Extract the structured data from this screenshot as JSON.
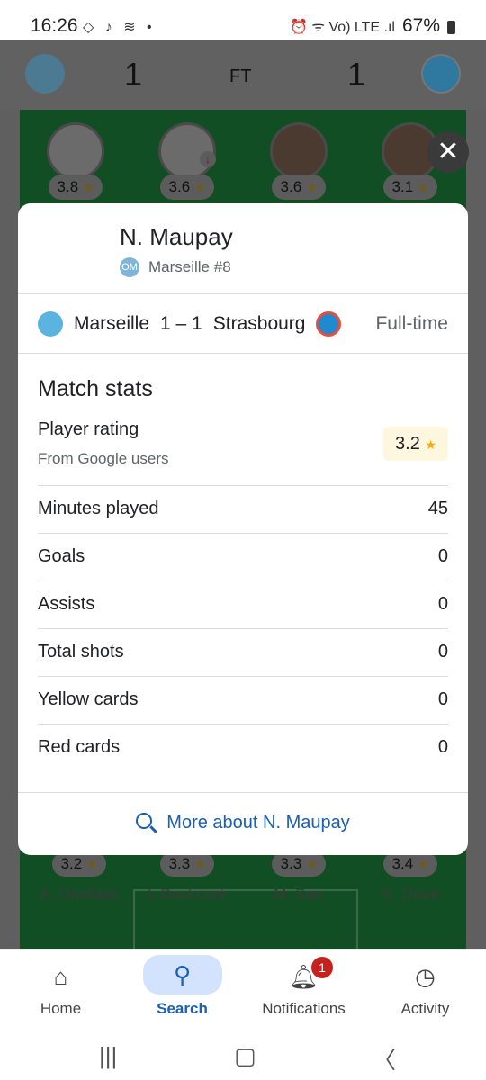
{
  "status_bar": {
    "time": "16:26",
    "left_icons": "◇ ♪ ≋ •",
    "right_icons": "⏰ ᯤ Vo) LTE .ıl",
    "battery": "67%"
  },
  "scoreboard": {
    "home_score": "1",
    "status": "FT",
    "away_score": "1"
  },
  "lineup_top": [
    {
      "rating": "3.8"
    },
    {
      "rating": "3.6",
      "sub": "↓"
    },
    {
      "rating": "3.6"
    },
    {
      "rating": "3.1"
    }
  ],
  "lineup_bottom": [
    {
      "rating": "3.2",
      "name": "A. Ouattara"
    },
    {
      "rating": "3.3",
      "name": "I. Doukouré"
    },
    {
      "rating": "3.3",
      "name": "M. Sarr"
    },
    {
      "rating": "3.4",
      "name": "G. Doué"
    }
  ],
  "player_card": {
    "name": "N. Maupay",
    "team_number": "Marseille #8",
    "match": {
      "home_team": "Marseille",
      "score": "1 – 1",
      "away_team": "Strasbourg",
      "status": "Full-time"
    },
    "section_title": "Match stats",
    "rating_label": "Player rating",
    "rating_source": "From Google users",
    "rating_value": "3.2",
    "stats": [
      {
        "label": "Minutes played",
        "value": "45"
      },
      {
        "label": "Goals",
        "value": "0"
      },
      {
        "label": "Assists",
        "value": "0"
      },
      {
        "label": "Total shots",
        "value": "0"
      },
      {
        "label": "Yellow cards",
        "value": "0"
      },
      {
        "label": "Red cards",
        "value": "0"
      }
    ],
    "more_link": "More about N. Maupay"
  },
  "bottom_nav": {
    "items": [
      {
        "label": "Home",
        "icon": "home-icon"
      },
      {
        "label": "Search",
        "icon": "search-icon",
        "active": true
      },
      {
        "label": "Notifications",
        "icon": "bell-icon",
        "badge": "1"
      },
      {
        "label": "Activity",
        "icon": "activity-icon"
      }
    ]
  },
  "colors": {
    "accent": "#1a5fb4",
    "pitch": "#124e24",
    "star": "#f9ab00",
    "badge": "#c5221f"
  }
}
